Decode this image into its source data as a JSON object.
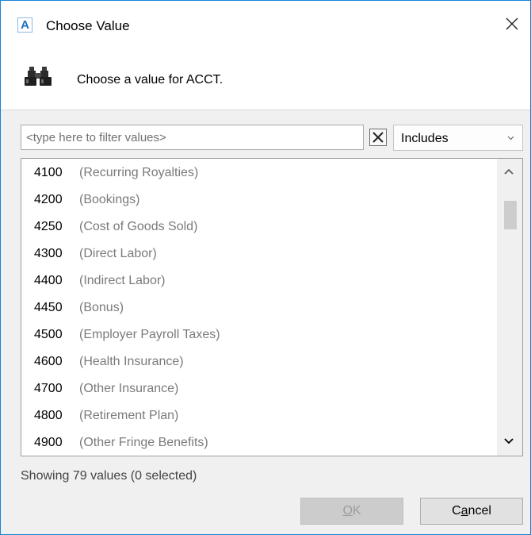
{
  "window": {
    "title": "Choose Value",
    "app_icon_letter": "A"
  },
  "header": {
    "prompt": "Choose a value for ACCT."
  },
  "filter": {
    "placeholder": "<type here to filter values>",
    "value": "",
    "mode": "Includes"
  },
  "items": [
    {
      "code": "4100",
      "desc": "(Recurring Royalties)"
    },
    {
      "code": "4200",
      "desc": "(Bookings)"
    },
    {
      "code": "4250",
      "desc": "(Cost of Goods Sold)"
    },
    {
      "code": "4300",
      "desc": "(Direct Labor)"
    },
    {
      "code": "4400",
      "desc": "(Indirect Labor)"
    },
    {
      "code": "4450",
      "desc": "(Bonus)"
    },
    {
      "code": "4500",
      "desc": "(Employer Payroll Taxes)"
    },
    {
      "code": "4600",
      "desc": "(Health Insurance)"
    },
    {
      "code": "4700",
      "desc": "(Other Insurance)"
    },
    {
      "code": "4800",
      "desc": "(Retirement Plan)"
    },
    {
      "code": "4900",
      "desc": "(Other Fringe Benefits)"
    }
  ],
  "status": "Showing 79 values (0 selected)",
  "buttons": {
    "ok": {
      "prefix": "",
      "underline": "O",
      "suffix": "K"
    },
    "cancel": {
      "prefix": "C",
      "underline": "a",
      "suffix": "ncel"
    }
  },
  "icons": {
    "app": "app-letter-icon",
    "close": "close-icon",
    "header": "binoculars-icon",
    "clear": "clear-filter-icon",
    "dropdown": "chevron-down-icon",
    "scroll_up": "scroll-up-icon",
    "scroll_down": "scroll-down-icon"
  },
  "colors": {
    "accent": "#1883d7",
    "item_desc": "#7a7a7a",
    "disabled_text": "#9d9d9d"
  }
}
